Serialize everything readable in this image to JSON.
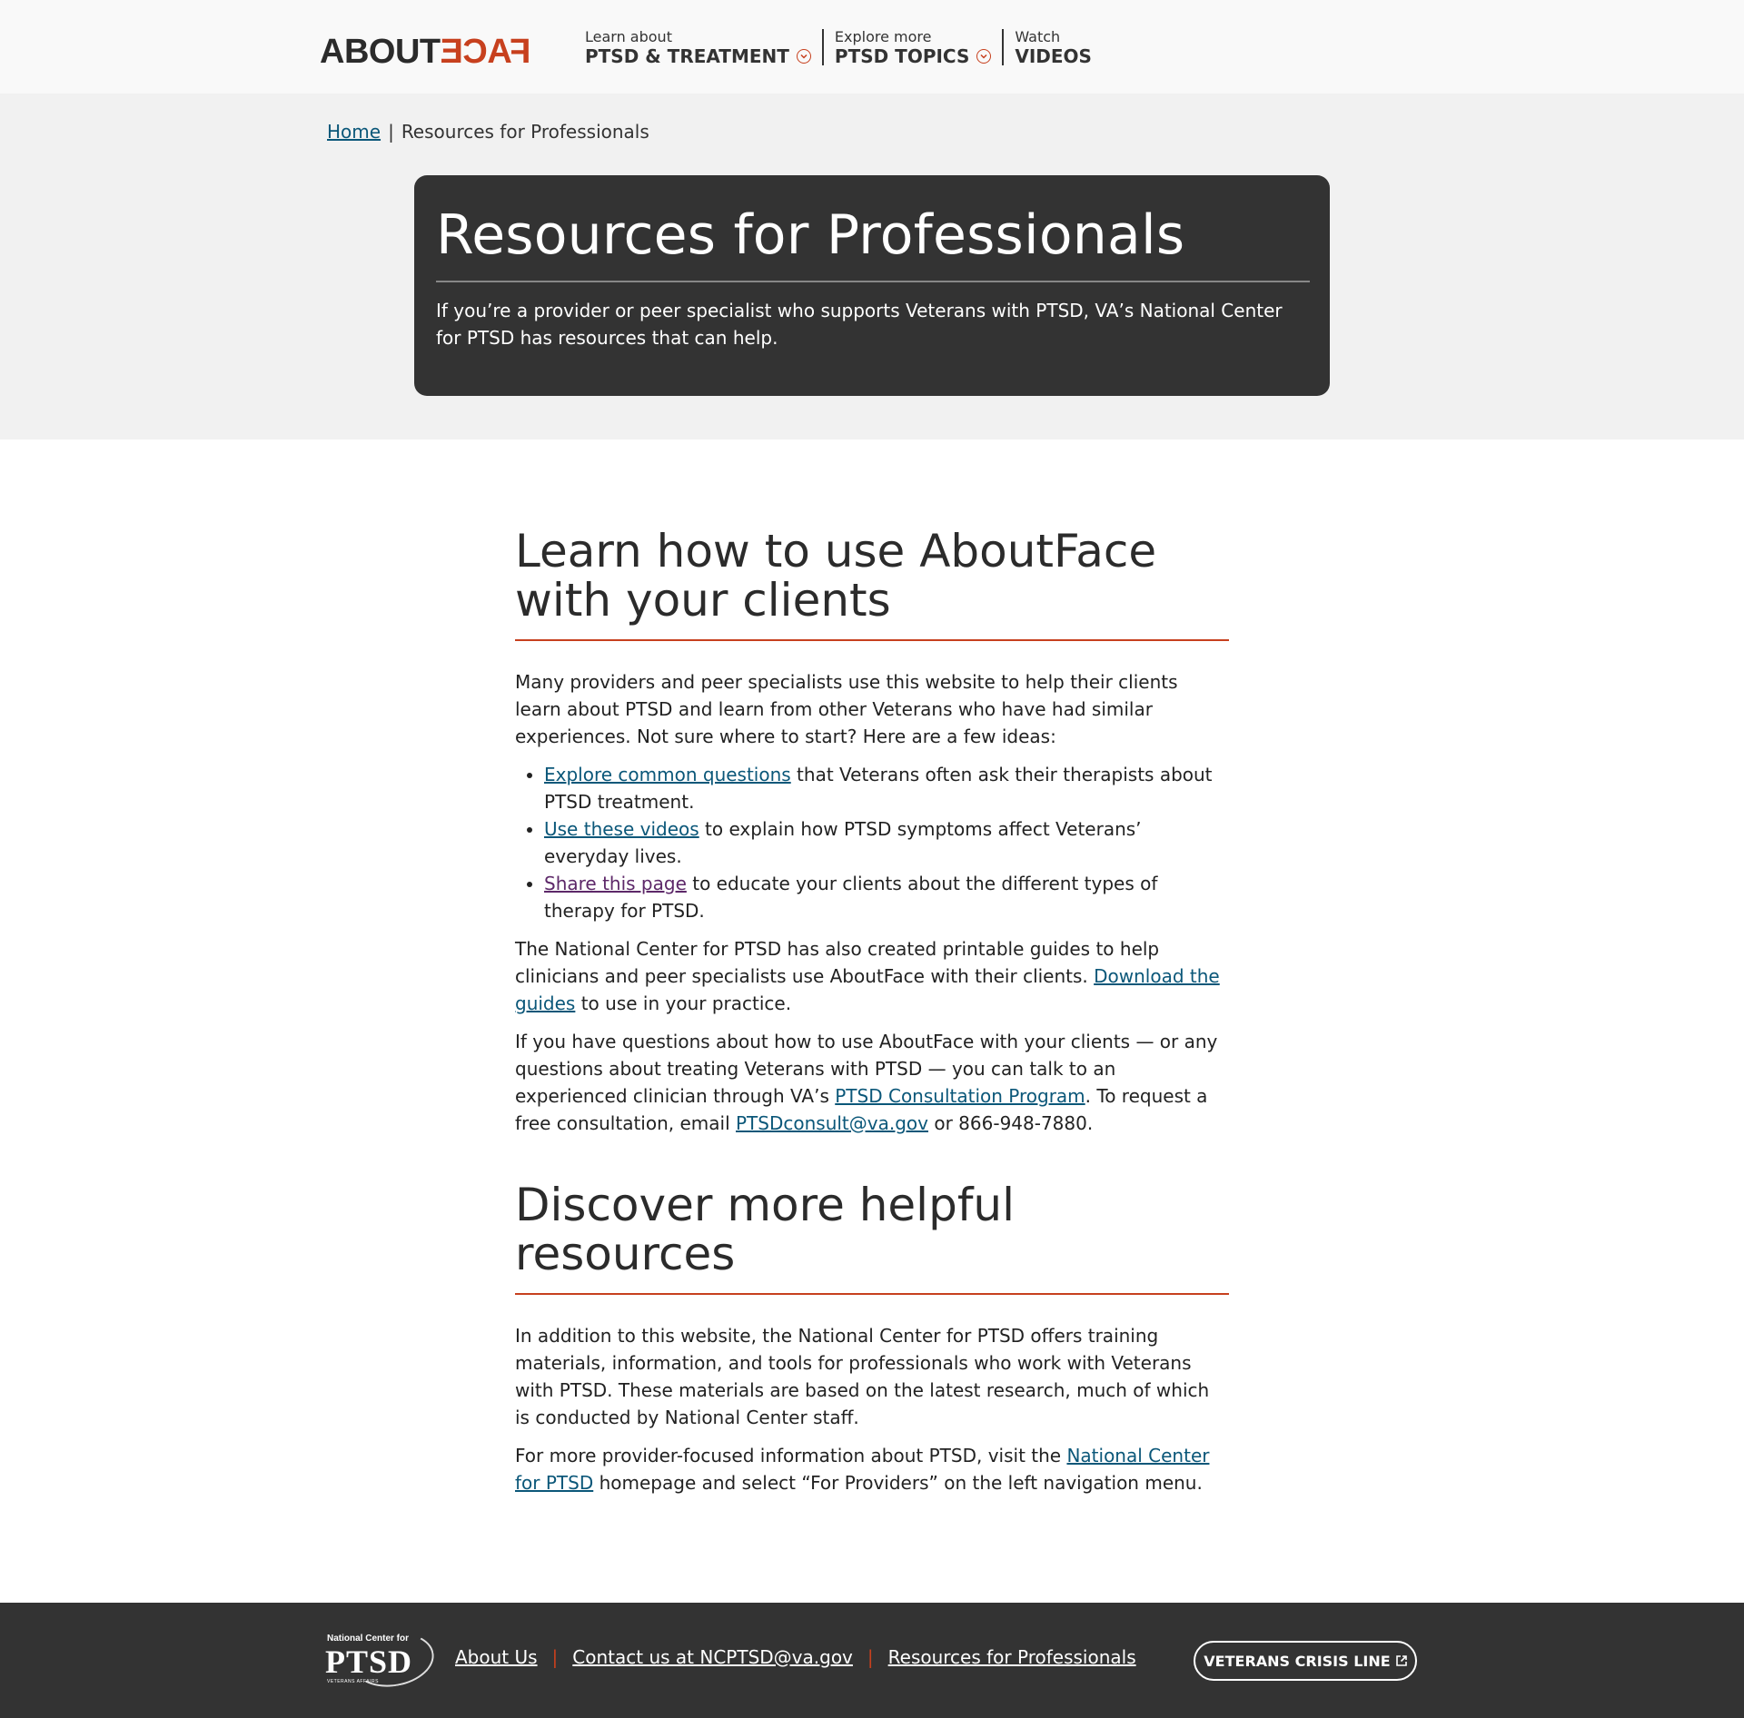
{
  "header": {
    "logo_about": "ABOUT",
    "logo_face": "FACE",
    "nav": [
      {
        "small": "Learn about",
        "big": "PTSD & TREATMENT",
        "dropdown": true
      },
      {
        "small": "Explore more",
        "big": "PTSD TOPICS",
        "dropdown": true
      },
      {
        "small": "Watch",
        "big": "VIDEOS",
        "dropdown": false
      }
    ]
  },
  "breadcrumb": {
    "home": "Home",
    "separator": "|",
    "current": "Resources for Professionals"
  },
  "hero": {
    "title": "Resources for Professionals",
    "text": "If you’re a provider or peer specialist who supports Veterans with PTSD, VA’s National Center for PTSD has resources that can help."
  },
  "section1": {
    "heading": "Learn how to use AboutFace with your clients",
    "intro": "Many providers and peer specialists use this website to help their clients learn about PTSD and learn from other Veterans who have had similar experiences. Not sure where to start? Here are a few ideas:",
    "ideas": [
      {
        "link": "Explore common questions",
        "text": " that Veterans often ask their therapists about PTSD treatment."
      },
      {
        "link": "Use these videos",
        "text": " to explain how PTSD symptoms affect Veterans’ everyday lives."
      },
      {
        "link": "Share this page",
        "text": " to educate your clients about the different types of therapy for PTSD."
      }
    ],
    "guides_pre": "The National Center for PTSD has also created printable guides to help clinicians and peer specialists use AboutFace with their clients. ",
    "guides_link": "Download the guides",
    "guides_post": " to use in your practice.",
    "consult_pre": "If you have questions about how to use AboutFace with your clients — or any questions about treating Veterans with PTSD — you can talk to an experienced clinician through VA’s ",
    "consult_link": "PTSD Consultation Program",
    "consult_mid": ". To request a free consultation, email ",
    "consult_email": "PTSDconsult@va.gov",
    "consult_post": " or 866-948-7880."
  },
  "section2": {
    "heading": "Discover more helpful resources",
    "p1": "In addition to this website, the National Center for PTSD offers training materials, information, and tools for professionals who work with Veterans with PTSD. These materials are based on the latest research, much of which is conducted by National Center staff.",
    "p2_pre": "For more provider-focused information about PTSD, visit the ",
    "p2_link": "National Center for PTSD",
    "p2_post": " homepage and select “For Providers” on the left navigation menu."
  },
  "footer": {
    "logo_small": "National Center for",
    "logo_word": "PTSD",
    "logo_tagline": "VETERANS AFFAIRS",
    "links": [
      "About Us",
      "Contact us at NCPTSD@va.gov",
      "Resources for Professionals"
    ],
    "separator": "|",
    "crisis_button": "VETERANS CRISIS LINE"
  },
  "colors": {
    "accent": "#c7401e",
    "link": "#0b5779",
    "visited_link": "#5d2869",
    "dark": "#333333"
  }
}
